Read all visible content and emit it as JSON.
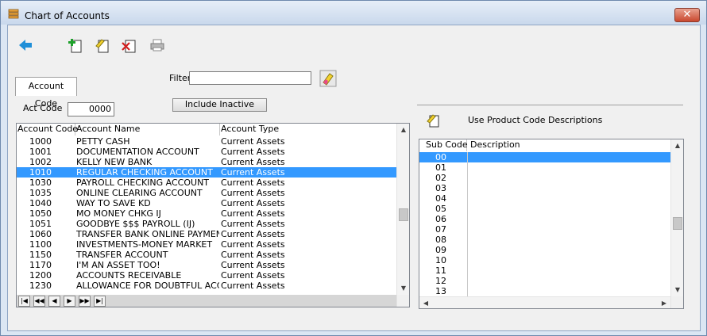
{
  "window": {
    "title": "Chart of Accounts",
    "close_glyph": "✕"
  },
  "toolbar": {
    "icons": [
      "back-arrow-icon",
      "add-record-icon",
      "edit-record-icon",
      "delete-record-icon",
      "print-icon"
    ]
  },
  "tab": {
    "label": "Account Code"
  },
  "filter": {
    "label": "Filter",
    "value": ""
  },
  "include_inactive_label": "Include Inactive",
  "act_code": {
    "label": "Act Code",
    "value": "0000"
  },
  "accounts": {
    "columns": [
      "Account Code",
      "Account Name",
      "Account Type"
    ],
    "rows": [
      {
        "code": "1000",
        "name": "PETTY CASH",
        "type": "Current Assets"
      },
      {
        "code": "1001",
        "name": "DOCUMENTATION ACCOUNT",
        "type": "Current Assets"
      },
      {
        "code": "1002",
        "name": "KELLY NEW BANK",
        "type": "Current Assets"
      },
      {
        "code": "1010",
        "name": "REGULAR CHECKING ACCOUNT",
        "type": "Current Assets"
      },
      {
        "code": "1030",
        "name": "PAYROLL CHECKING ACCOUNT",
        "type": "Current Assets"
      },
      {
        "code": "1035",
        "name": "ONLINE CLEARING ACCOUNT",
        "type": "Current Assets"
      },
      {
        "code": "1040",
        "name": "WAY TO SAVE   KD",
        "type": "Current Assets"
      },
      {
        "code": "1050",
        "name": "MO MONEY CHKG IJ",
        "type": "Current Assets"
      },
      {
        "code": "1051",
        "name": "GOODBYE $$$ PAYROLL (IJ)",
        "type": "Current Assets"
      },
      {
        "code": "1060",
        "name": "TRANSFER BANK ONLINE PAYMENT",
        "type": "Current Assets"
      },
      {
        "code": "1100",
        "name": "INVESTMENTS-MONEY MARKET",
        "type": "Current Assets"
      },
      {
        "code": "1150",
        "name": "TRANSFER ACCOUNT",
        "type": "Current Assets"
      },
      {
        "code": "1170",
        "name": "I'M AN ASSET TOO!",
        "type": "Current Assets"
      },
      {
        "code": "1200",
        "name": "ACCOUNTS RECEIVABLE",
        "type": "Current Assets"
      },
      {
        "code": "1230",
        "name": "ALLOWANCE FOR DOUBTFUL ACCOUNTS",
        "type": "Current Assets"
      }
    ],
    "selected_row": 3,
    "nav_buttons": [
      "|◀",
      "◀◀",
      "◀",
      "▶",
      "▶▶",
      "▶|"
    ]
  },
  "use_product_label": "Use Product Code Descriptions",
  "subcodes": {
    "columns": [
      "Sub Code",
      "Description"
    ],
    "rows": [
      "00",
      "01",
      "02",
      "03",
      "04",
      "05",
      "06",
      "07",
      "08",
      "09",
      "10",
      "11",
      "12",
      "13"
    ],
    "selected_row": 0
  },
  "colors": {
    "selection": "#3399ff",
    "back_arrow": "#1f8fd8"
  }
}
